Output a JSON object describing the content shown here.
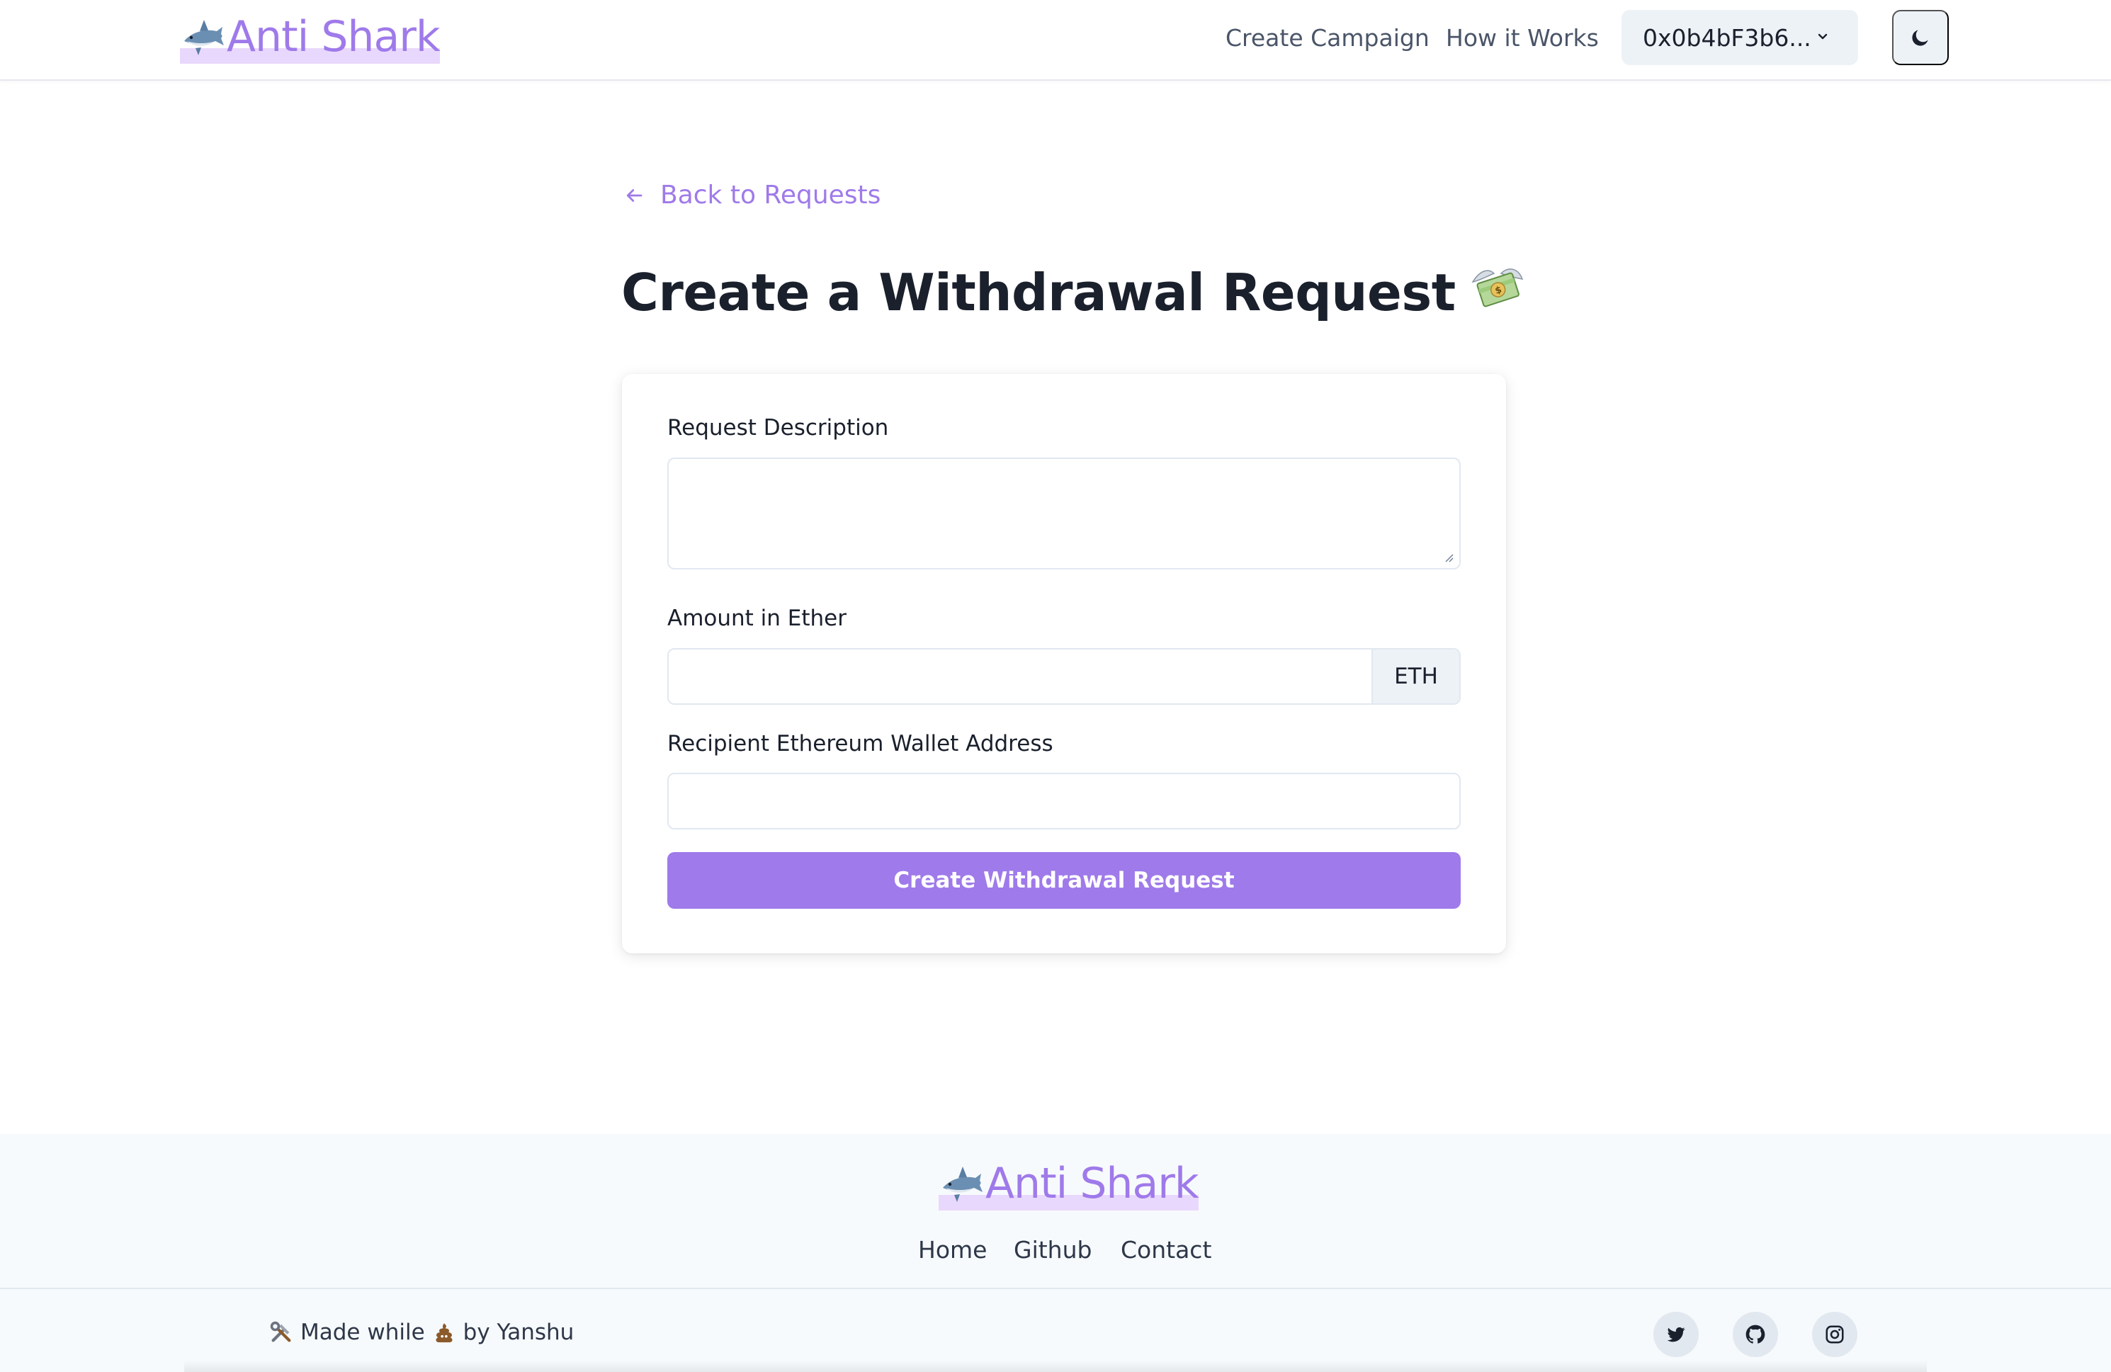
{
  "header": {
    "logo_emoji": "🦈",
    "logo_text": "Anti Shark",
    "nav": {
      "create_campaign": "Create Campaign",
      "how_it_works": "How it Works"
    },
    "wallet_address": "0x0b4bF3b6...",
    "theme_toggle_icon": "moon-icon"
  },
  "main": {
    "back_link": "Back to Requests",
    "title": "Create a Withdrawal Request",
    "title_emoji": "💸",
    "form": {
      "description_label": "Request Description",
      "description_value": "",
      "amount_label": "Amount in Ether",
      "amount_value": "",
      "amount_unit": "ETH",
      "recipient_label": "Recipient Ethereum Wallet Address",
      "recipient_value": "",
      "submit_label": "Create Withdrawal Request"
    }
  },
  "footer": {
    "logo_emoji": "🦈",
    "logo_text": "Anti Shark",
    "links": {
      "home": "Home",
      "github": "Github",
      "contact": "Contact"
    },
    "made_by": {
      "tools_emoji": "🛠",
      "text_made_while": "Made while",
      "poop_emoji": "💩",
      "text_by": "by Yanshu"
    },
    "social": [
      "twitter-icon",
      "github-icon",
      "instagram-icon"
    ]
  },
  "colors": {
    "accent": "#9f7aea",
    "accent_light": "#e9d8fd",
    "button_gray": "#edf2f7",
    "footer_bg": "#f7fafc"
  }
}
